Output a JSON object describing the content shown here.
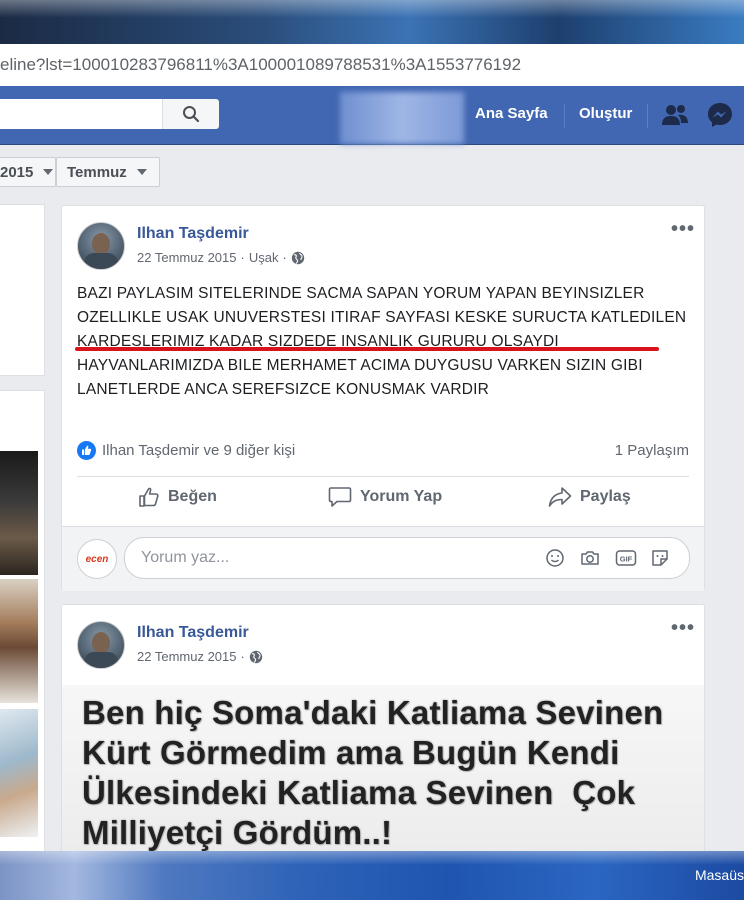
{
  "browser": {
    "url": "eline?lst=100010283796811%3A100001089788531%3A1553776192"
  },
  "navbar": {
    "search_placeholder": "",
    "links": [
      "Ana Sayfa",
      "Oluştur"
    ],
    "icons": [
      "search-icon",
      "friends-icon",
      "messenger-icon"
    ],
    "color": "#4267b2"
  },
  "filters": {
    "year": "2015",
    "month": "Temmuz"
  },
  "posts": [
    {
      "author": "Ilhan Taşdemir",
      "date": "22 Temmuz 2015",
      "location": "Uşak",
      "separator": "·",
      "text": "BAZI PAYLASIM SITELERINDE SACMA SAPAN YORUM YAPAN BEYINSIZLER OZELLIKLE USAK UNUVERSTESI ITIRAF SAYFASI KESKE SURUCTA KATLEDILEN KARDESLERIMIZ KADAR SIZDEDE INSANLIK GURURU OLSAYDI HAYVANLARIMIZDA BILE MERHAMET ACIMA DUYGUSU VARKEN SIZIN GIBI LANETLERDE ANCA SEREFSIZCE KONUSMAK VARDIR",
      "reactions": "Ilhan Taşdemir ve 9 diğer kişi",
      "shares": "1 Paylaşım",
      "actions": [
        "Beğen",
        "Yorum Yap",
        "Paylaş"
      ],
      "comment_placeholder": "Yorum yaz...",
      "commenter_avatar": "ecen",
      "underline_color": "#d9131c"
    },
    {
      "author": "Ilhan Taşdemir",
      "date": "22 Temmuz 2015",
      "separator": "·",
      "image_text": [
        "Ben hiç Soma'daki Katliama Sevinen",
        "Kürt Görmedim ama Bugün Kendi",
        "Ülkesindeki Katliama Sevinen  Çok",
        "Milliyetçi Gördüm..!"
      ]
    }
  ],
  "taskbar": {
    "label": "Masaüs"
  }
}
